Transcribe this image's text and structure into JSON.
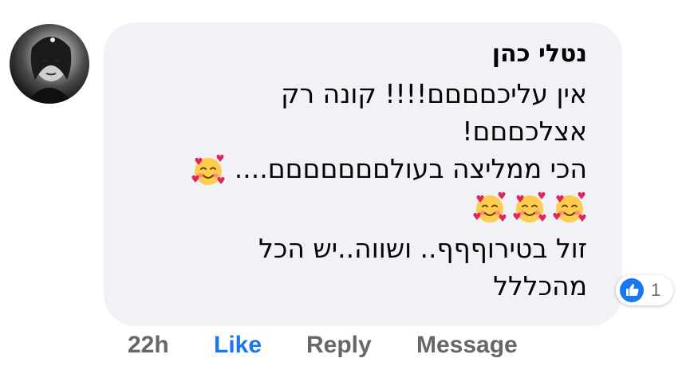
{
  "comment": {
    "author": "נטלי כהן",
    "lines": [
      "אין עליכםםםם!!!! קונה רק",
      "אצלכםםם!",
      "הכי ממליצה  בעולםםםםםםם...."
    ],
    "lines_after": [
      "זול בטירוףףף.. ושווה..יש הכל",
      "מהכללל"
    ],
    "emoji": "smiling-face-with-hearts"
  },
  "reactions": {
    "type": "like",
    "count": "1",
    "color": "#1877f2"
  },
  "actions": {
    "time": "22h",
    "like": "Like",
    "reply": "Reply",
    "message": "Message"
  },
  "colors": {
    "bubble": "#f0f2f5",
    "text": "#050505",
    "muted": "#65676b",
    "accent": "#1877f2"
  }
}
